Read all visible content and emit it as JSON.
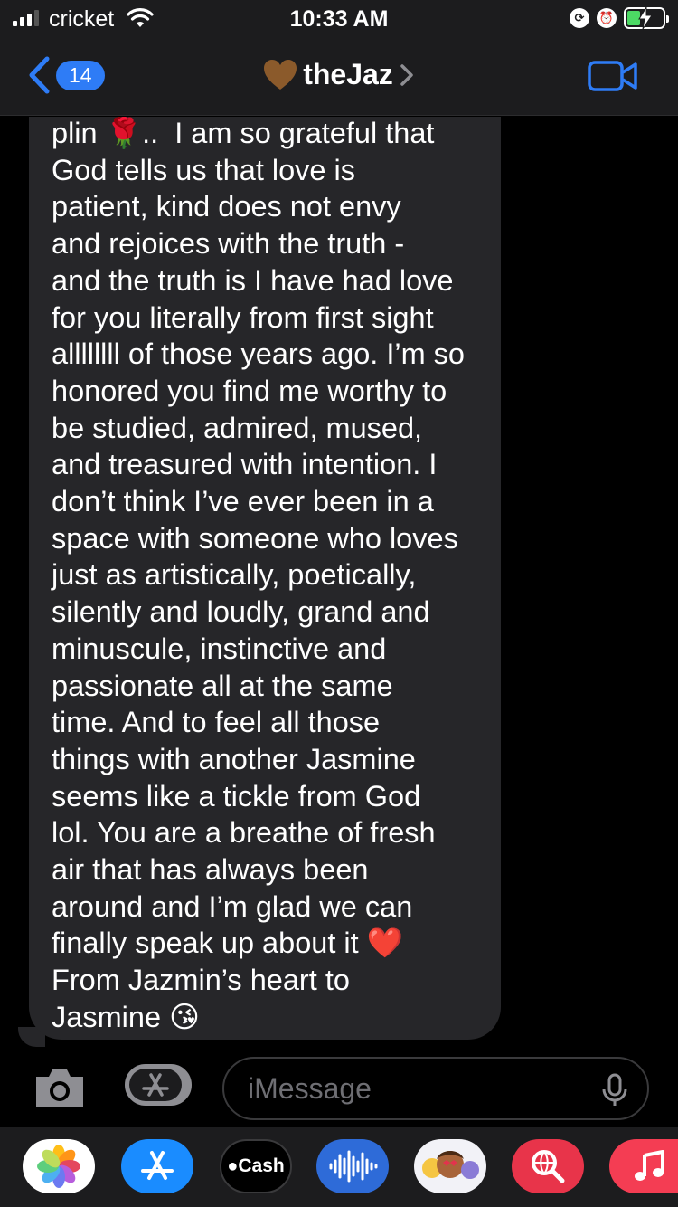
{
  "status_bar": {
    "carrier": "cricket",
    "time": "10:33 AM",
    "signal_bars": 3
  },
  "header": {
    "back_badge": "14",
    "contact_name": "theJaz",
    "contact_avatar_icon": "brown-heart-icon",
    "video_icon": "video-camera-icon"
  },
  "message": {
    "text": "plin 🌹..  I am so grateful that\nGod tells us that love is\npatient, kind does not envy\nand rejoices with the truth -\nand the truth is I have had love\nfor you literally from first sight\nallllllll of those years ago. I’m so\nhonored you find me worthy to\nbe studied, admired, mused,\nand treasured with intention. I\ndon’t think I’ve ever been in a\nspace with someone who loves\njust as artistically, poetically,\nsilently and loudly, grand and\nminuscule, instinctive and\npassionate all at the same\ntime. And to feel all those\nthings with another Jasmine\nseems like a tickle from God\nlol. You are a breathe of fresh\nair that has always been\naround and I’m glad we can\nfinally speak up about it ❤️\nFrom Jazmin’s heart to\nJasmine 😘"
  },
  "input_bar": {
    "placeholder": "iMessage",
    "camera_icon": "camera-icon",
    "apps_icon": "app-store-icon",
    "mic_icon": "microphone-icon"
  },
  "app_drawer": {
    "apps": [
      {
        "name": "Photos",
        "icon": "photos-icon"
      },
      {
        "name": "App Store",
        "icon": "app-store-icon"
      },
      {
        "name": "Cash",
        "label": "Cash",
        "icon": "apple-cash-icon"
      },
      {
        "name": "Audio",
        "icon": "audio-waveform-icon"
      },
      {
        "name": "Memoji",
        "icon": "memoji-icon"
      },
      {
        "name": "Images",
        "icon": "image-search-icon"
      },
      {
        "name": "Music",
        "icon": "music-note-icon"
      }
    ]
  },
  "colors": {
    "accent": "#2e7cf6",
    "bubble": "#262629",
    "background": "#000000",
    "bar": "#1c1c1e",
    "battery_charge": "#4cd964"
  }
}
